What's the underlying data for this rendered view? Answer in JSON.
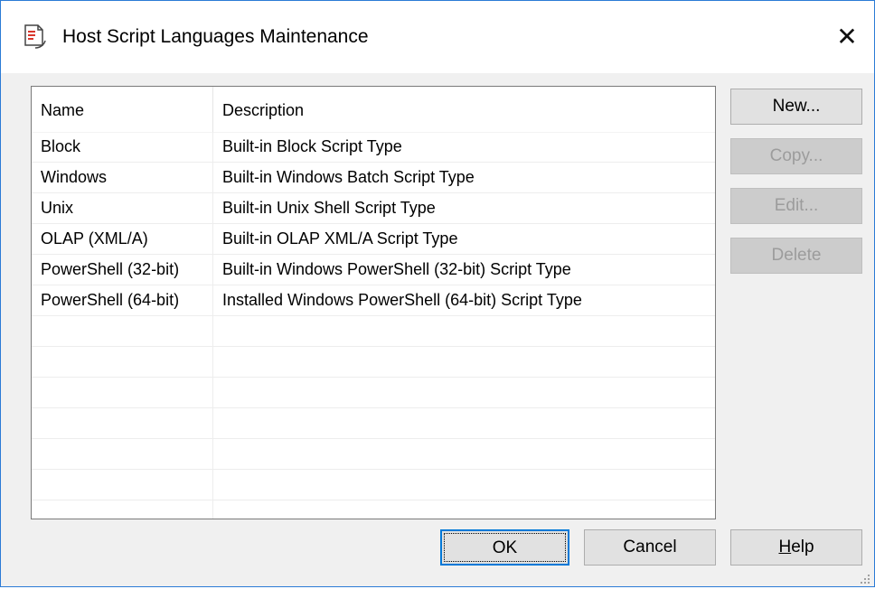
{
  "window": {
    "title": "Host Script Languages Maintenance",
    "close_glyph": "✕",
    "icon": "script-document-icon"
  },
  "table": {
    "columns": [
      "Name",
      "Description"
    ],
    "rows": [
      {
        "name": "Block",
        "description": "Built-in Block Script Type"
      },
      {
        "name": "Windows",
        "description": "Built-in Windows Batch Script Type"
      },
      {
        "name": "Unix",
        "description": "Built-in Unix Shell Script Type"
      },
      {
        "name": "OLAP (XML/A)",
        "description": "Built-in OLAP XML/A Script Type"
      },
      {
        "name": "PowerShell (32-bit)",
        "description": "Built-in Windows PowerShell (32-bit) Script Type"
      },
      {
        "name": "PowerShell (64-bit)",
        "description": "Installed Windows PowerShell (64-bit) Script Type"
      }
    ],
    "empty_rows": 7
  },
  "side_buttons": {
    "new": "New...",
    "copy": "Copy...",
    "edit": "Edit...",
    "delete": "Delete"
  },
  "bottom_buttons": {
    "ok": "OK",
    "cancel": "Cancel",
    "help_mnemonic": "H",
    "help_rest": "elp"
  },
  "colors": {
    "window_border": "#2b7bd6",
    "dialog_bg": "#f0f0f0",
    "button_bg": "#e1e1e1",
    "default_button_border": "#0078d7",
    "disabled_text": "#9c9c9c"
  }
}
